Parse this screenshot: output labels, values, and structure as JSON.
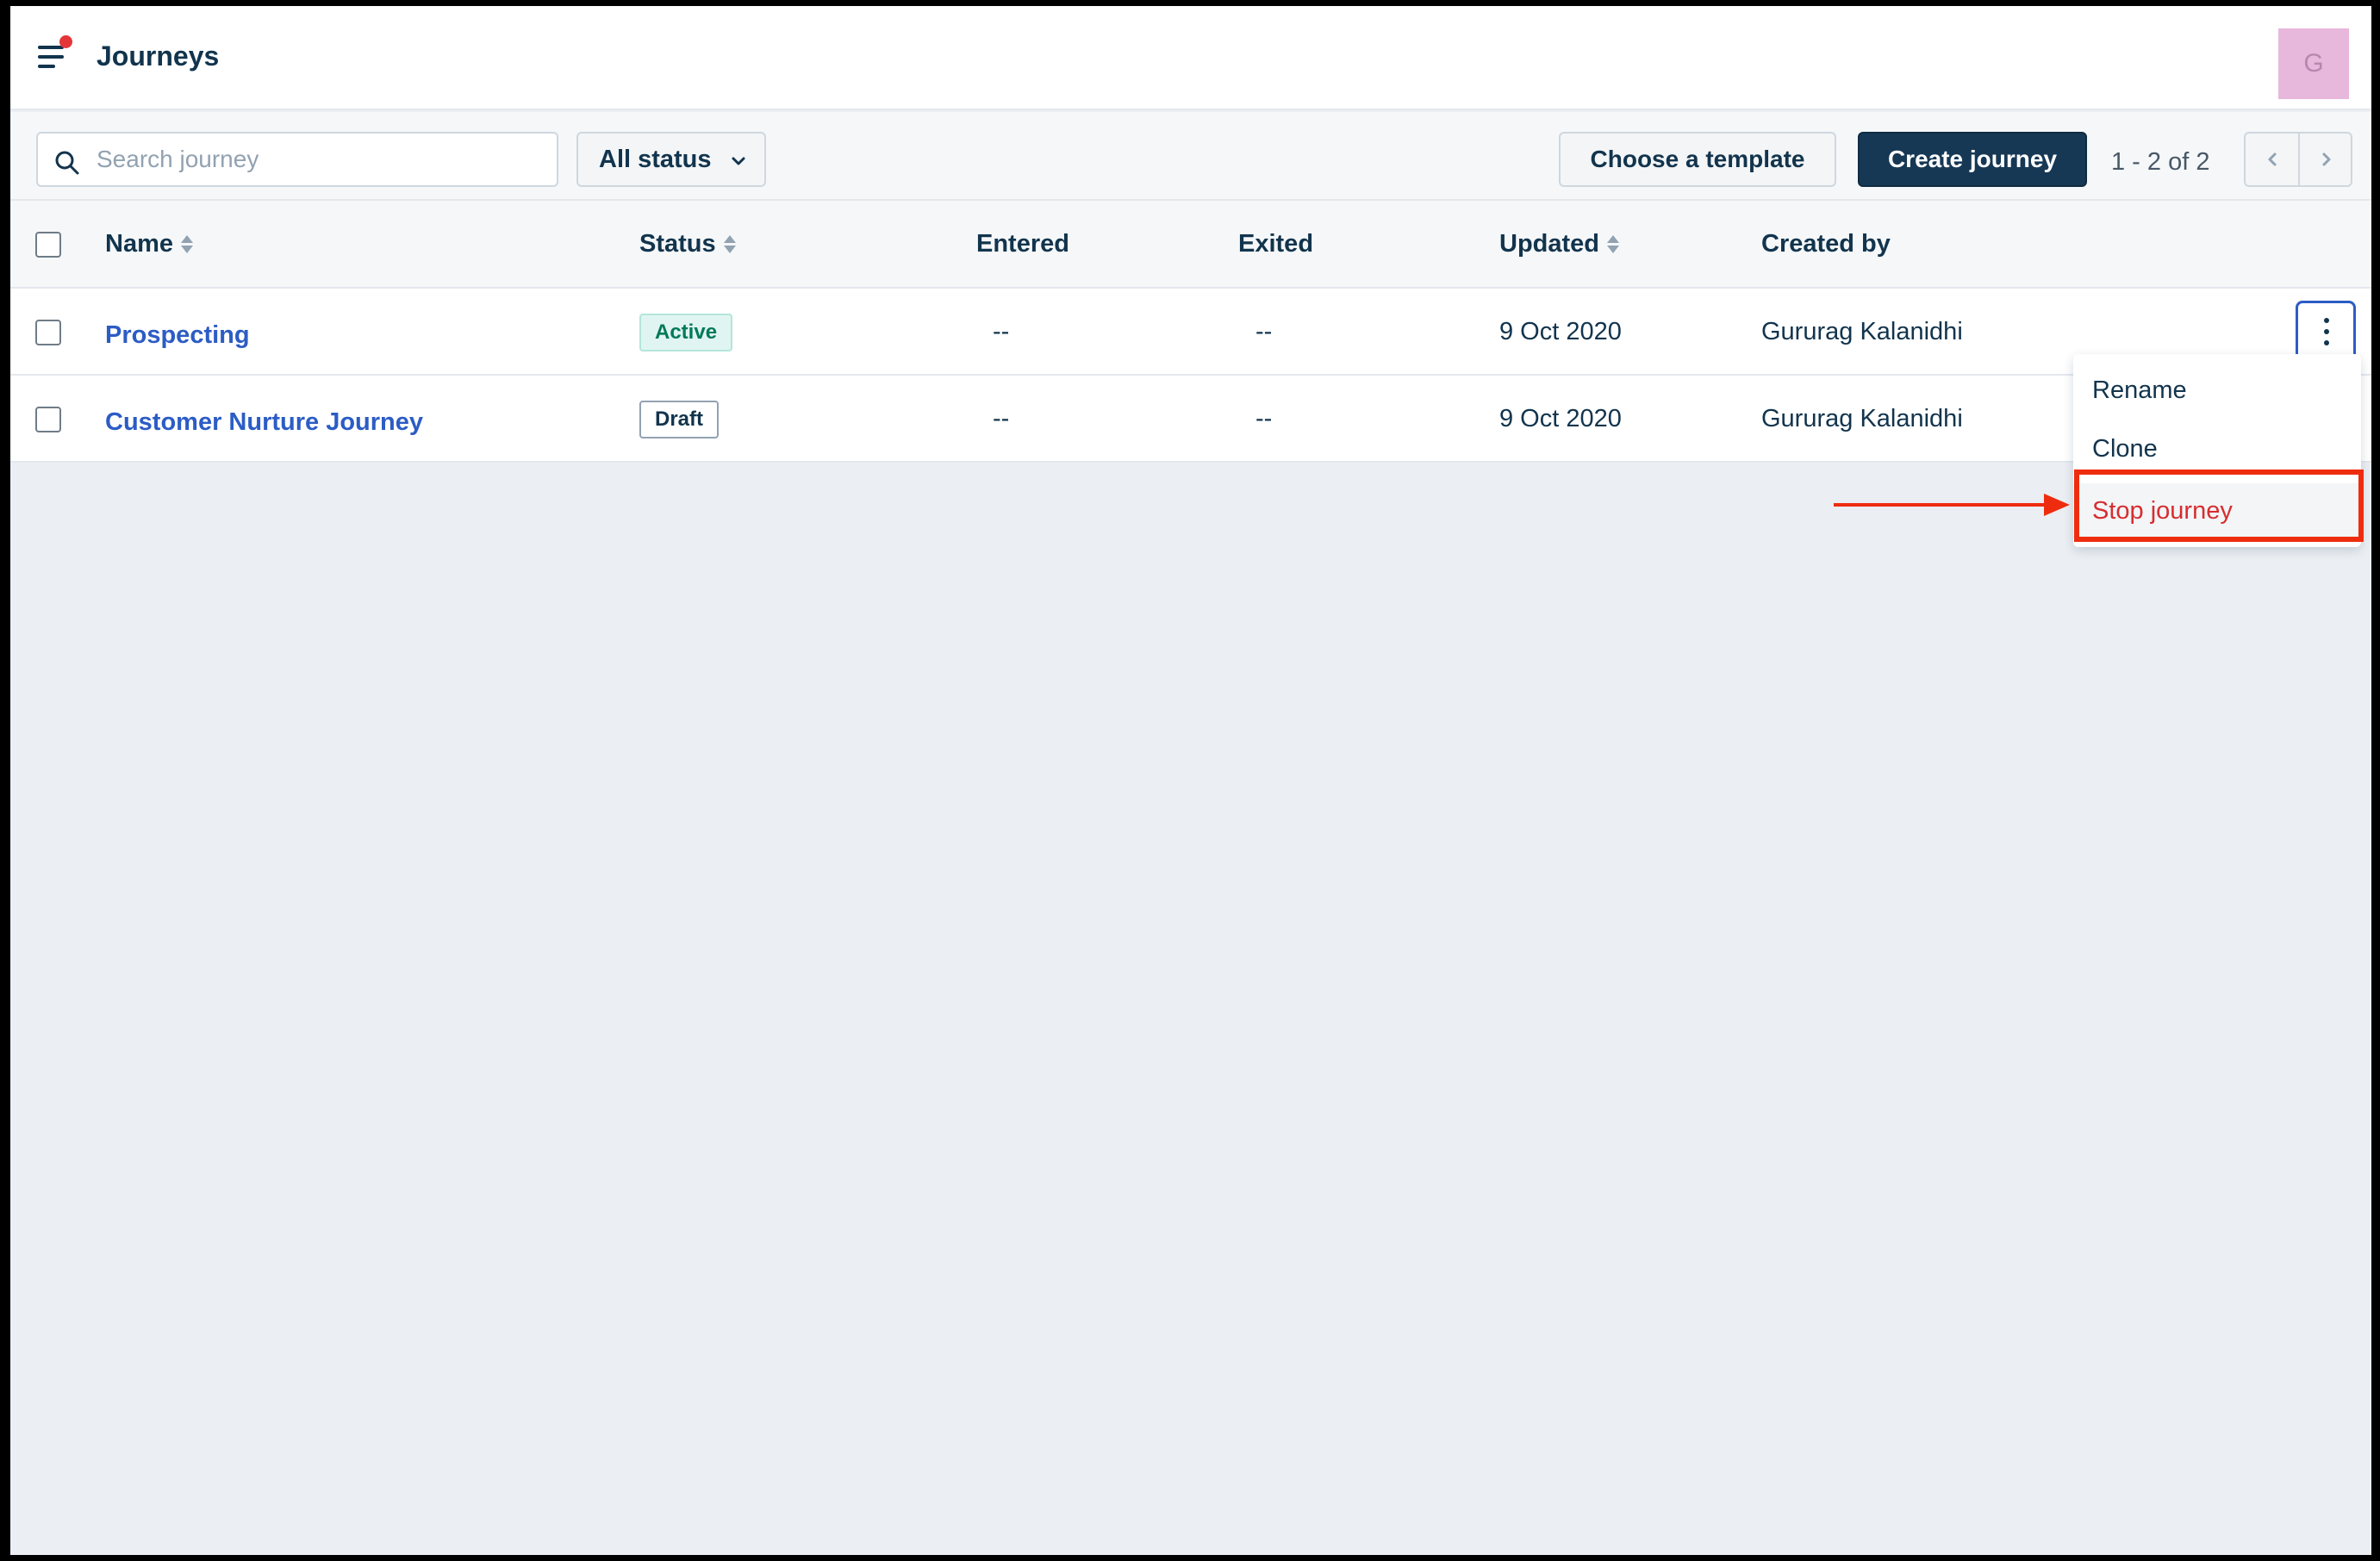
{
  "header": {
    "title": "Journeys",
    "avatar_initial": "G",
    "notification_color": "#e43538"
  },
  "toolbar": {
    "search_placeholder": "Search journey",
    "status_filter": "All status",
    "choose_template": "Choose a template",
    "create_journey": "Create journey",
    "pagination": "1 - 2 of 2"
  },
  "table": {
    "columns": {
      "name": "Name",
      "status": "Status",
      "entered": "Entered",
      "exited": "Exited",
      "updated": "Updated",
      "created_by": "Created by"
    },
    "rows": [
      {
        "name": "Prospecting",
        "status": "Active",
        "entered": "--",
        "exited": "--",
        "updated": "9 Oct 2020",
        "created_by": "Gururag Kalanidhi"
      },
      {
        "name": "Customer Nurture Journey",
        "status": "Draft",
        "entered": "--",
        "exited": "--",
        "updated": "9 Oct 2020",
        "created_by": "Gururag Kalanidhi"
      }
    ]
  },
  "row_menu": {
    "items": [
      "Rename",
      "Clone",
      "Stop journey"
    ]
  },
  "colors": {
    "primary": "#163854",
    "link": "#2c5cc5",
    "annotation": "#ee2d0f",
    "danger": "#d72d30"
  }
}
